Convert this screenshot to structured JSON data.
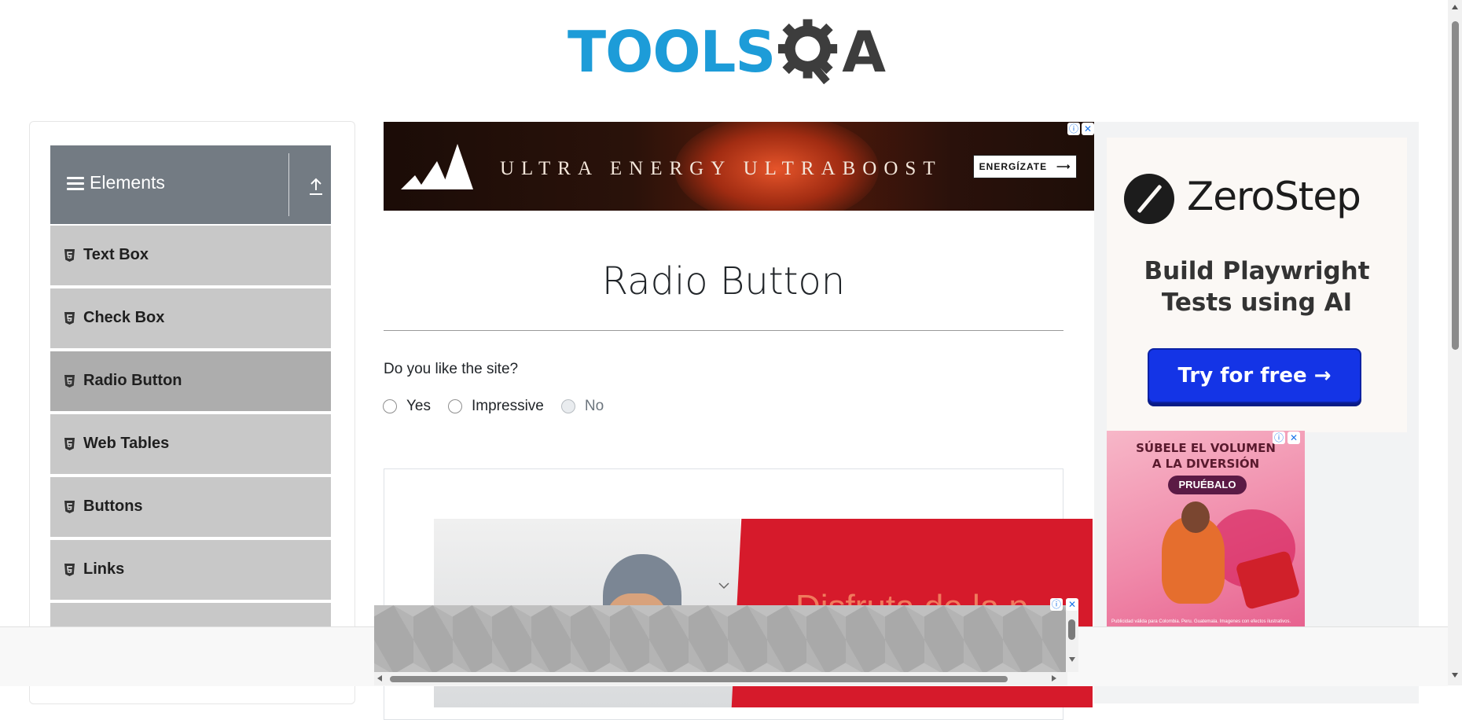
{
  "logo": {
    "part1": "TOOLS",
    "part2": "QA"
  },
  "sidebar": {
    "group_title": "Elements",
    "items": [
      {
        "label": "Text Box",
        "active": false
      },
      {
        "label": "Check Box",
        "active": false
      },
      {
        "label": "Radio Button",
        "active": true
      },
      {
        "label": "Web Tables",
        "active": false
      },
      {
        "label": "Buttons",
        "active": false
      },
      {
        "label": "Links",
        "active": false
      }
    ]
  },
  "top_ad": {
    "text": "ULTRA ENERGY   ULTRABOOST",
    "cta": "ENERGÍZATE"
  },
  "main": {
    "title": "Radio Button",
    "question": "Do you like the site?",
    "options": [
      {
        "label": "Yes",
        "disabled": false
      },
      {
        "label": "Impressive",
        "disabled": false
      },
      {
        "label": "No",
        "disabled": true
      }
    ]
  },
  "inner_ad": {
    "text": "Disfruta de la p"
  },
  "right_ad": {
    "brand": "ZeroStep",
    "tagline_1": "Build Playwright",
    "tagline_2": "Tests using AI",
    "button": "Try for free →"
  },
  "pink_ad": {
    "line1": "SÚBELE EL VOLUMEN",
    "line2": "A LA DIVERSIÓN",
    "button": "PRUÉBALO",
    "fine_print": "Publicidad válida para Colombia. Peru. Guatemala. Imagenes con efectos ilustrativos."
  },
  "colors": {
    "brand_blue": "#1d9cd8",
    "sidebar_header": "#737b83",
    "menu_item": "#c8c8c8",
    "menu_item_active": "#adadad",
    "zerostep_button": "#1434e6"
  }
}
